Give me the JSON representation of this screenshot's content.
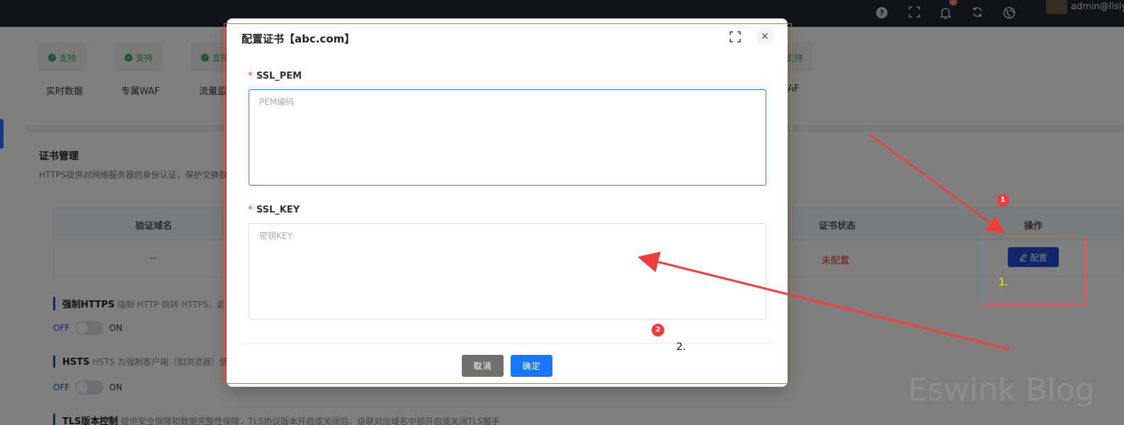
{
  "topbar": {
    "icons": [
      "help-icon",
      "fullscreen-icon",
      "bell-icon",
      "refresh-icon",
      "globe-icon"
    ],
    "notification_count": "0",
    "user": "admin@lisiy"
  },
  "features": [
    {
      "status": "支持",
      "label": "实时数据"
    },
    {
      "status": "支持",
      "label": "专属WAF"
    },
    {
      "status": "支持",
      "label": "流量监控"
    },
    {
      "status": "支持",
      "label": "WAF"
    }
  ],
  "cert_section": {
    "title": "证书管理",
    "desc": "HTTPS提供对网络服务器的身份认证，保护交换数据",
    "columns": [
      "验证域名",
      "证书状态",
      "操作"
    ],
    "row": {
      "domain": "--",
      "status": "未配置",
      "action": "配置"
    }
  },
  "options": [
    {
      "title": "强制HTTPS",
      "desc": "强制 HTTP 跳转 HTTPS，启用",
      "off": "OFF",
      "on": "ON"
    },
    {
      "title": "HSTS",
      "desc": "HSTS 为强制客户端（如浏览器）使用",
      "off": "OFF",
      "on": "ON"
    },
    {
      "title": "TLS版本控制",
      "desc": "提供安全保障和数据完整性保障，TLS协议版本开启或关闭后，级联对应域名中部开启或关闭TLS握手"
    }
  ],
  "modal": {
    "title": "配置证书【abc.com】",
    "pem_label": "SSL_PEM",
    "pem_placeholder": "PEM编码",
    "key_label": "SSL_KEY",
    "key_placeholder": "密钥KEY",
    "cancel": "取消",
    "confirm": "确定"
  },
  "annotations": {
    "circle1": "1",
    "circle2": "2",
    "text1": "1.",
    "text2": "2.",
    "color": "#f03e3e",
    "text1_color": "#ffff00"
  },
  "watermark": "Eswink Blog"
}
